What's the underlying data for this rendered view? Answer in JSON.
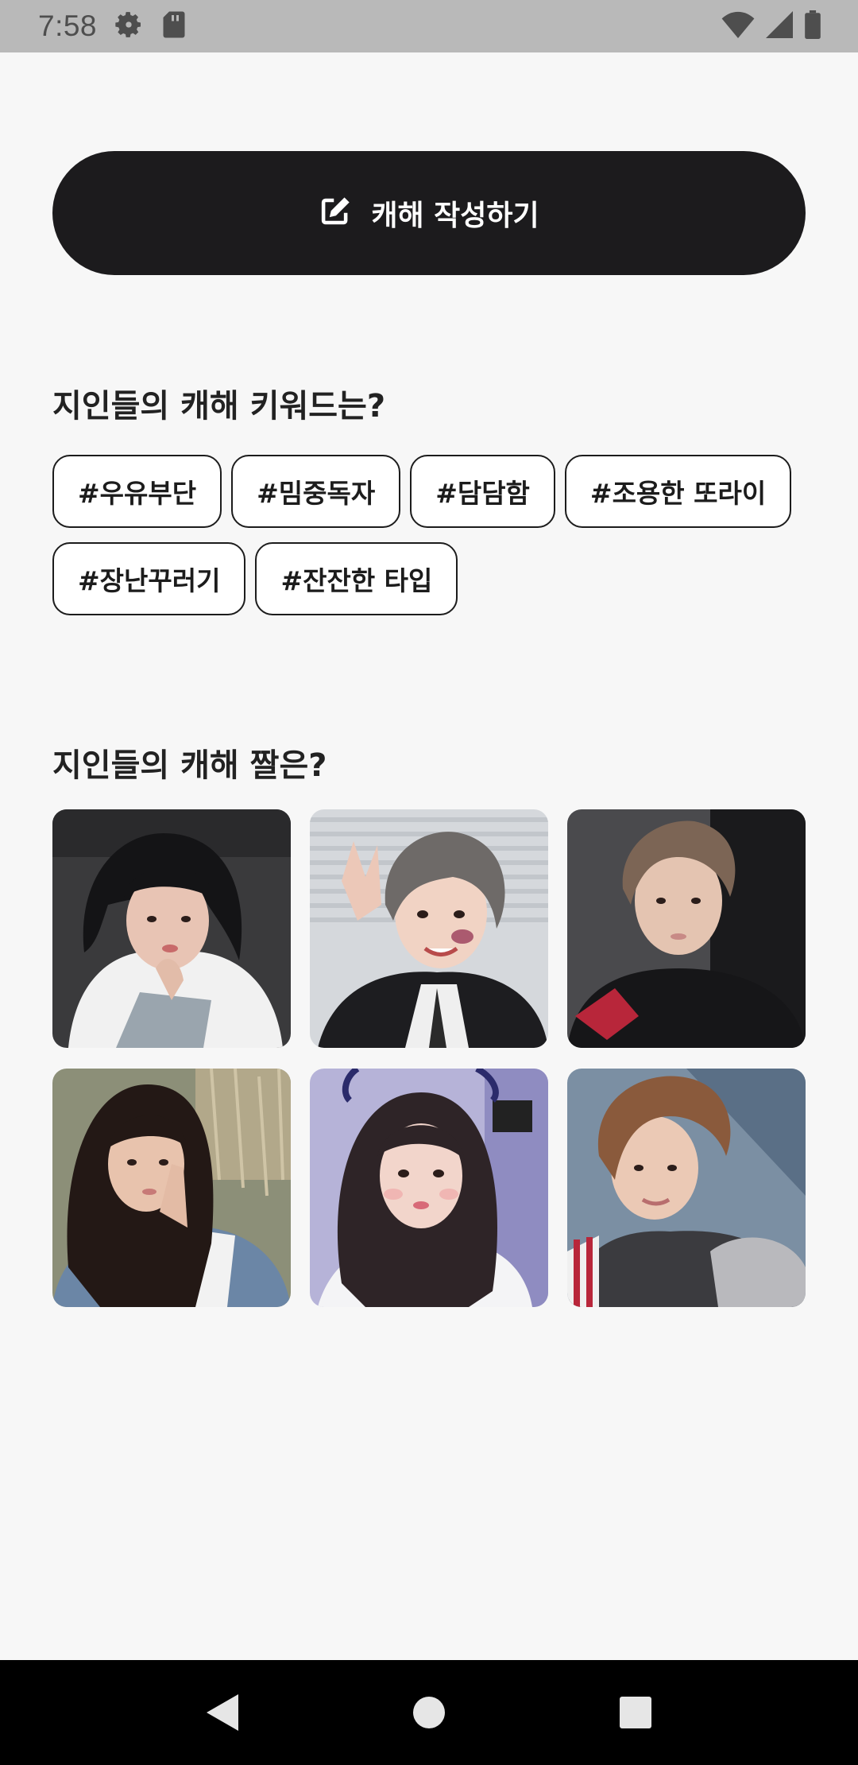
{
  "status_bar": {
    "time": "7:58",
    "icons": [
      "settings-icon",
      "sd-card-icon",
      "wifi-icon",
      "signal-icon",
      "battery-icon"
    ]
  },
  "write_button": {
    "icon": "edit-icon",
    "label": "캐해 작성하기"
  },
  "keywords_section": {
    "title": "지인들의 캐해 키워드는?",
    "chips": [
      "#우유부단",
      "#밈중독자",
      "#담담함",
      "#조용한 또라이",
      "#장난꾸러기",
      "#잔잔한 타입"
    ]
  },
  "photos_section": {
    "title": "지인들의 캐해 짤은?",
    "photos": [
      {
        "name": "photo-1"
      },
      {
        "name": "photo-2"
      },
      {
        "name": "photo-3"
      },
      {
        "name": "photo-4"
      },
      {
        "name": "photo-5"
      },
      {
        "name": "photo-6"
      }
    ]
  },
  "nav_bar": {
    "buttons": [
      "back-icon",
      "home-icon",
      "recents-icon"
    ]
  },
  "colors": {
    "primary_dark": "#1c1b1d",
    "background": "#f7f7f7",
    "status_bar": "#b9b9b9"
  }
}
